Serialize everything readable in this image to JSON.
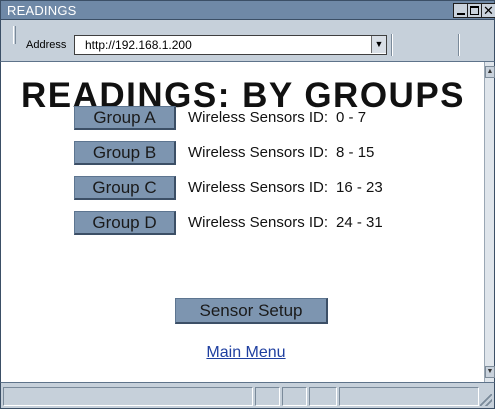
{
  "window": {
    "title": "READINGS",
    "controls": {
      "minimize_icon": "minimize-icon",
      "maximize_icon": "maximize-icon",
      "close_glyph": "✕",
      "close_icon": "close-icon"
    }
  },
  "addressbar": {
    "label": "Address",
    "url": "http://192.168.1.200",
    "dropdown_glyph": "▼",
    "dropdown_icon": "chevron-down-icon"
  },
  "page": {
    "title": "READINGS: BY GROUPS",
    "groups": [
      {
        "label": "Group A",
        "description": "Wireless Sensors ID:",
        "range": "0 - 7"
      },
      {
        "label": "Group B",
        "description": "Wireless Sensors ID:",
        "range": "8 - 15"
      },
      {
        "label": "Group C",
        "description": "Wireless Sensors ID:",
        "range": "16 - 23"
      },
      {
        "label": "Group D",
        "description": "Wireless Sensors ID:",
        "range": "24 - 31"
      }
    ],
    "setup_button": "Sensor Setup",
    "main_menu_link": "Main Menu"
  },
  "scrollbar": {
    "up_glyph": "▲",
    "down_glyph": "▼"
  },
  "colors": {
    "titlebar": "#6f89a7",
    "chrome": "#c6d0da",
    "button": "#7d95b0",
    "link": "#1f3fa0"
  }
}
